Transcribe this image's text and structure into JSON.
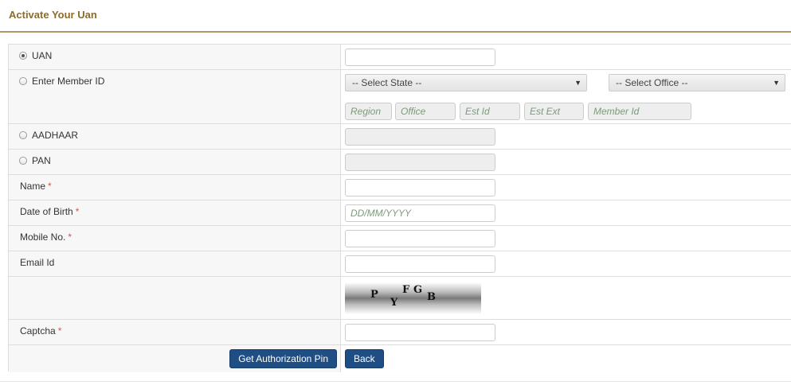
{
  "page": {
    "title": "Activate Your Uan"
  },
  "options": {
    "uan": "UAN",
    "member_id": "Enter Member ID",
    "aadhaar": "AADHAAR",
    "pan": "PAN"
  },
  "selects": {
    "state": "-- Select State --",
    "office": "-- Select Office --"
  },
  "member_fields": {
    "region": "Region",
    "office": "Office",
    "est_id": "Est Id",
    "est_ext": "Est Ext",
    "member_id": "Member Id"
  },
  "fields": {
    "name": "Name",
    "dob": "Date of Birth",
    "dob_placeholder": "DD/MM/YYYY",
    "mobile": "Mobile No.",
    "email": "Email Id",
    "captcha": "Captcha",
    "required_mark": "*"
  },
  "captcha_text": {
    "c1": "P",
    "c2": "Y",
    "c3": "F",
    "c4": "G",
    "c5": "B"
  },
  "buttons": {
    "authorize": "Get Authorization Pin",
    "back": "Back"
  },
  "colors": {
    "title": "#8b6b2e",
    "button": "#1f4e85",
    "required": "#d9534f"
  }
}
